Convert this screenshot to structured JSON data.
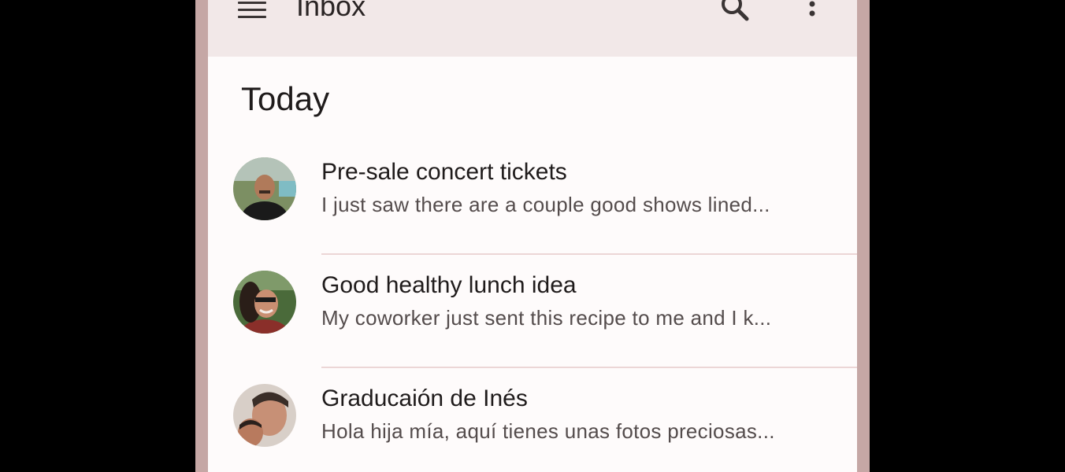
{
  "app_bar": {
    "title": "Inbox",
    "menu_icon": "hamburger-menu-icon",
    "search_icon": "search-icon",
    "more_icon": "more-vert-icon"
  },
  "section": {
    "title": "Today"
  },
  "messages": [
    {
      "title": "Pre-sale concert tickets",
      "preview": "I just saw there are a couple good shows lined..."
    },
    {
      "title": "Good healthy lunch idea",
      "preview": "My coworker just sent this recipe to me and I k..."
    },
    {
      "title": "Graducaión de Inés",
      "preview": "Hola hija mía, aquí tienes unas fotos preciosas..."
    }
  ],
  "colors": {
    "background": "#000000",
    "frame": "#c5a7a5",
    "app_bar": "#f2e8e8",
    "surface": "#fefbfb",
    "divider": "#ecd6d6"
  }
}
